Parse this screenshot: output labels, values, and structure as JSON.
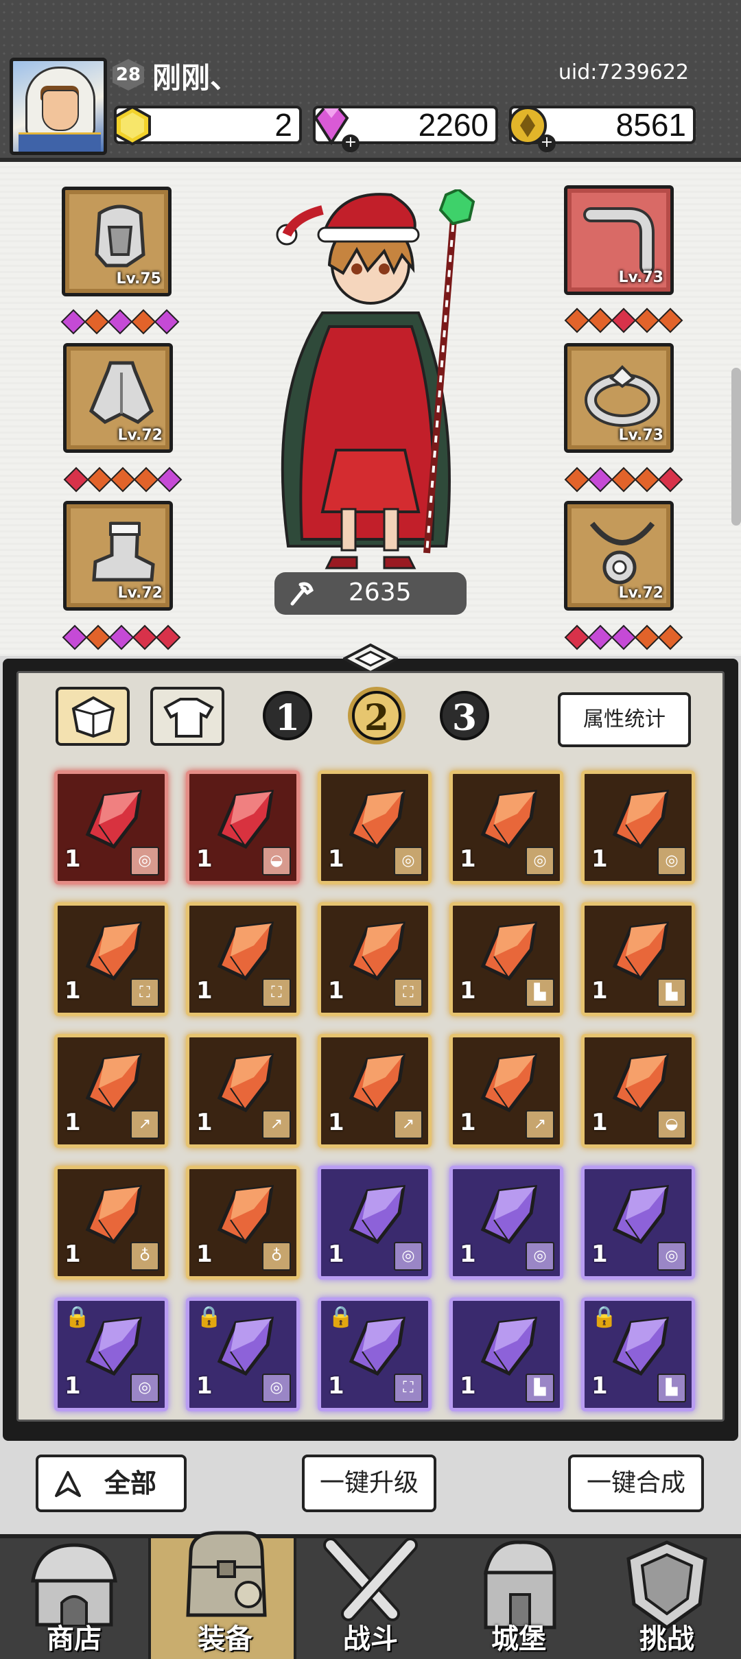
{
  "player": {
    "level": "28",
    "name": "刚刚、",
    "uid": "uid:7239622"
  },
  "resources": {
    "energy": "2",
    "gems": "2260",
    "coins": "8561"
  },
  "equipment": {
    "left": [
      {
        "name": "helmet",
        "level": "Lv.75"
      },
      {
        "name": "armor",
        "level": "Lv.72"
      },
      {
        "name": "boots",
        "level": "Lv.72"
      }
    ],
    "right": [
      {
        "name": "weapon",
        "level": "Lv.73"
      },
      {
        "name": "ring",
        "level": "Lv.73"
      },
      {
        "name": "necklace",
        "level": "Lv.72"
      }
    ]
  },
  "power": "2635",
  "panel": {
    "tabs": [
      "1",
      "2",
      "3"
    ],
    "active_tab": "2",
    "stats_label": "属性统计"
  },
  "gems_grid": [
    {
      "rarity": "red",
      "count": "1",
      "slot": "ring"
    },
    {
      "rarity": "red",
      "count": "1",
      "slot": "helmet"
    },
    {
      "rarity": "orange",
      "count": "1",
      "slot": "ring"
    },
    {
      "rarity": "orange",
      "count": "1",
      "slot": "ring"
    },
    {
      "rarity": "orange",
      "count": "1",
      "slot": "ring"
    },
    {
      "rarity": "orange",
      "count": "1",
      "slot": "armor"
    },
    {
      "rarity": "orange",
      "count": "1",
      "slot": "armor"
    },
    {
      "rarity": "orange",
      "count": "1",
      "slot": "armor"
    },
    {
      "rarity": "orange",
      "count": "1",
      "slot": "boots"
    },
    {
      "rarity": "orange",
      "count": "1",
      "slot": "boots"
    },
    {
      "rarity": "orange",
      "count": "1",
      "slot": "weapon"
    },
    {
      "rarity": "orange",
      "count": "1",
      "slot": "weapon"
    },
    {
      "rarity": "orange",
      "count": "1",
      "slot": "weapon"
    },
    {
      "rarity": "orange",
      "count": "1",
      "slot": "weapon"
    },
    {
      "rarity": "orange",
      "count": "1",
      "slot": "helmet"
    },
    {
      "rarity": "orange",
      "count": "1",
      "slot": "necklace"
    },
    {
      "rarity": "orange",
      "count": "1",
      "slot": "necklace"
    },
    {
      "rarity": "purple",
      "count": "1",
      "slot": "ring"
    },
    {
      "rarity": "purple",
      "count": "1",
      "slot": "ring"
    },
    {
      "rarity": "purple",
      "count": "1",
      "slot": "ring"
    },
    {
      "rarity": "purple",
      "count": "1",
      "slot": "ring",
      "locked": true
    },
    {
      "rarity": "purple",
      "count": "1",
      "slot": "ring",
      "locked": true
    },
    {
      "rarity": "purple",
      "count": "1",
      "slot": "armor",
      "locked": true
    },
    {
      "rarity": "purple",
      "count": "1",
      "slot": "boots"
    },
    {
      "rarity": "purple",
      "count": "1",
      "slot": "boots",
      "locked": true
    }
  ],
  "actions": {
    "filter": "全部",
    "upgrade_all": "一键升级",
    "merge_all": "一键合成"
  },
  "nav": [
    {
      "label": "商店",
      "icon": "shop-icon"
    },
    {
      "label": "装备",
      "icon": "bag-icon",
      "active": true
    },
    {
      "label": "战斗",
      "icon": "swords-icon"
    },
    {
      "label": "城堡",
      "icon": "castle-icon"
    },
    {
      "label": "挑战",
      "icon": "shield-icon"
    }
  ],
  "colors": {
    "orange_gem": "#e8673a",
    "red_gem": "#d8323f",
    "purple_gem": "#8d62d9",
    "gold_border": "#e6c370"
  }
}
